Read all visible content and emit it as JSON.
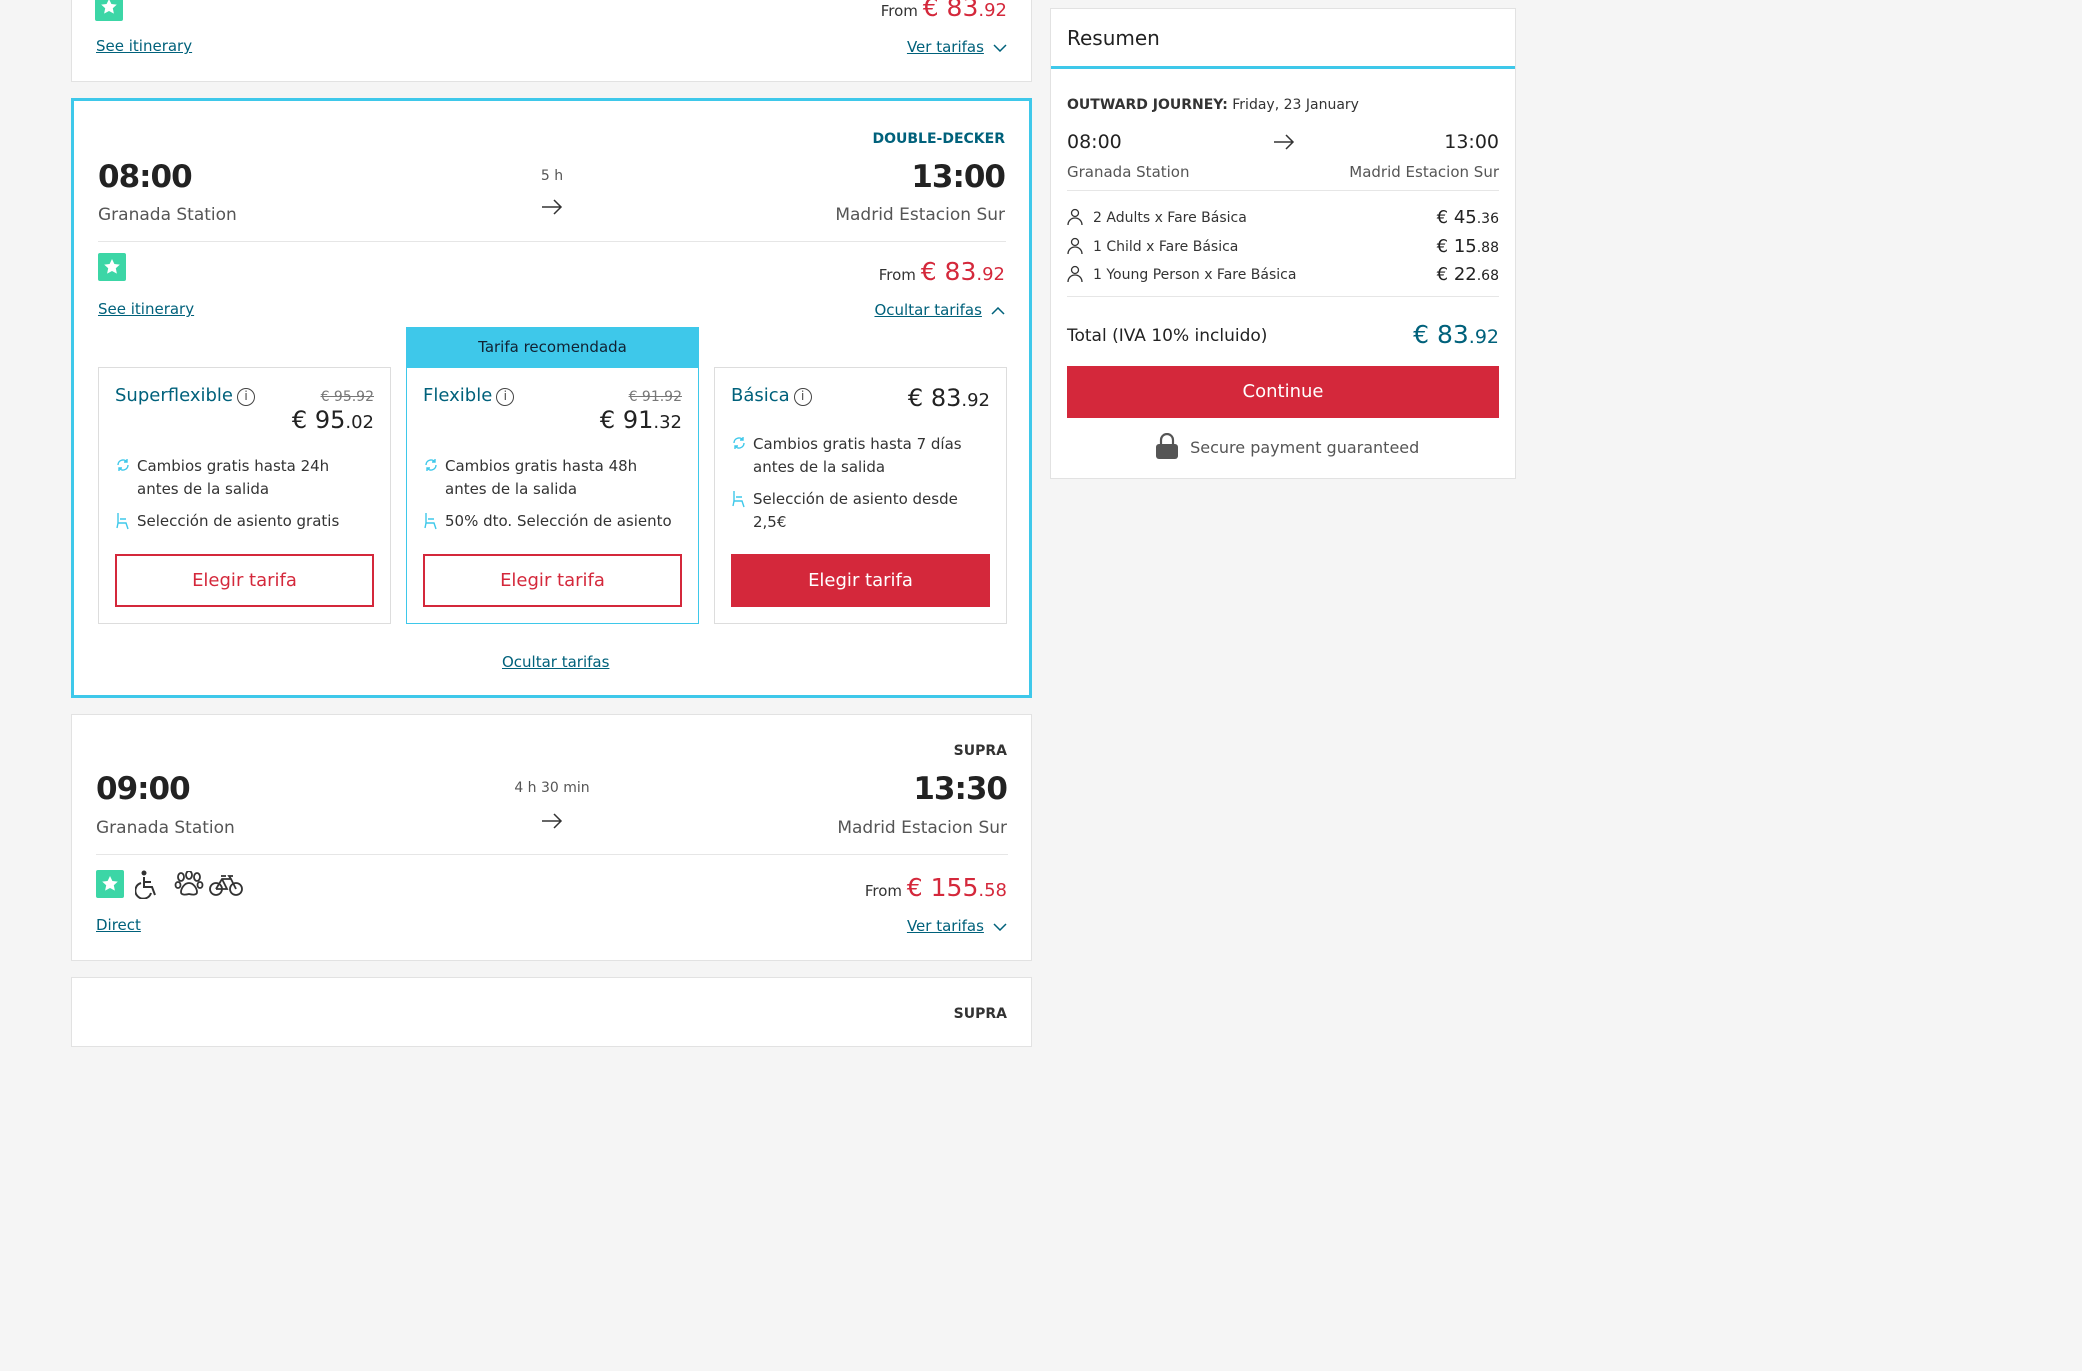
{
  "top_card": {
    "see_itinerary": "See itinerary",
    "from_label": "From",
    "price_main": "€ 83",
    "price_cents": ".92",
    "fares_toggle": "Ver tarifas"
  },
  "selected_card": {
    "tag": "DOUBLE-DECKER",
    "depart_time": "08:00",
    "arrive_time": "13:00",
    "duration": "5 h",
    "origin": "Granada Station",
    "destination": "Madrid Estacion Sur",
    "from_label": "From",
    "price_main": "€ 83",
    "price_cents": ".92",
    "see_itinerary": "See itinerary",
    "fares_toggle": "Ocultar tarifas",
    "recommended_label": "Tarifa recomendada",
    "bottom_hide": "Ocultar tarifas",
    "fares": [
      {
        "name": "Superflexible",
        "old_price": "€ 95.92",
        "price_main": "€ 95",
        "price_cents": ".02",
        "feature1": "Cambios gratis hasta 24h antes de la salida",
        "feature2": "Selección de asiento gratis",
        "button": "Elegir tarifa"
      },
      {
        "name": "Flexible",
        "old_price": "€ 91.92",
        "price_main": "€ 91",
        "price_cents": ".32",
        "feature1": "Cambios gratis hasta 48h antes de la salida",
        "feature2": "50% dto. Selección de asiento",
        "button": "Elegir tarifa"
      },
      {
        "name": "Básica",
        "price_main": "€ 83",
        "price_cents": ".92",
        "feature1": "Cambios gratis hasta 7 días antes de la salida",
        "feature2": "Selección de asiento desde 2,5€",
        "button": "Elegir tarifa"
      }
    ]
  },
  "third_card": {
    "tag": "SUPRA",
    "depart_time": "09:00",
    "arrive_time": "13:30",
    "duration": "4 h 30 min",
    "origin": "Granada Station",
    "destination": "Madrid Estacion Sur",
    "from_label": "From",
    "price_main": "€ 155",
    "price_cents": ".58",
    "direct": "Direct",
    "fares_toggle": "Ver tarifas"
  },
  "fourth_card": {
    "tag": "SUPRA"
  },
  "summary": {
    "title": "Resumen",
    "journey_label": "OUTWARD JOURNEY:",
    "journey_date": "Friday, 23 January",
    "depart_time": "08:00",
    "arrive_time": "13:00",
    "origin": "Granada Station",
    "destination": "Madrid Estacion Sur",
    "passengers": [
      {
        "label": "2 Adults x Fare Básica",
        "price_main": "€ 45",
        "price_cents": ".36"
      },
      {
        "label": "1 Child x Fare Básica",
        "price_main": "€ 15",
        "price_cents": ".88"
      },
      {
        "label": "1 Young Person x Fare Básica",
        "price_main": "€ 22",
        "price_cents": ".68"
      }
    ],
    "total_label": "Total (IVA 10% incluido)",
    "total_main": "€ 83",
    "total_cents": ".92",
    "continue": "Continue",
    "secure": "Secure payment guaranteed"
  },
  "colors": {
    "accent_red": "#d4283b",
    "accent_cyan": "#3ec8ea",
    "link_teal": "#00617b",
    "star_green": "#3cd6a6"
  },
  "icons": [
    "star-icon",
    "arrow-right-icon",
    "chevron-down-icon",
    "chevron-up-icon",
    "info-icon",
    "refresh-icon",
    "seat-icon",
    "wheelchair-icon",
    "paw-icon",
    "bicycle-icon",
    "person-icon",
    "lock-icon"
  ]
}
